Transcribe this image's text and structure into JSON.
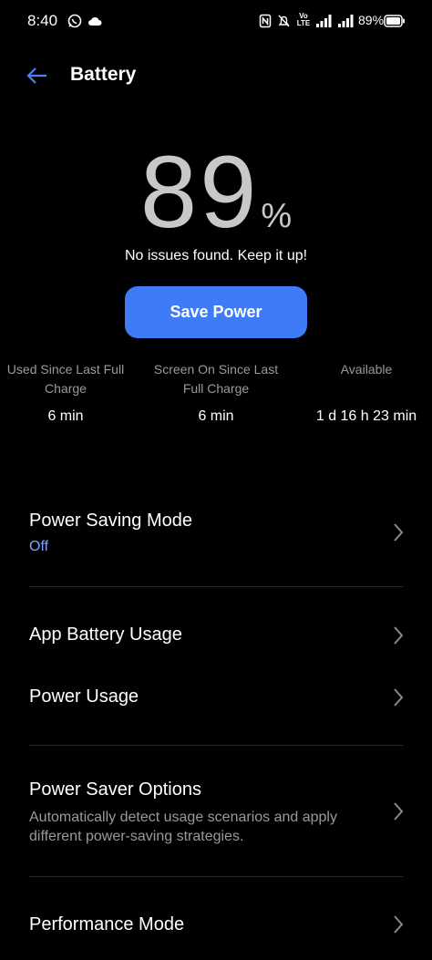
{
  "status_bar": {
    "time": "8:40",
    "battery_percent": "89%",
    "icons": [
      "whatsapp-icon",
      "cloud-icon",
      "nfc-icon",
      "mute-icon",
      "volte-icon",
      "signal-icon",
      "signal-icon",
      "battery-icon"
    ],
    "volte_text": "Vo LTE"
  },
  "header": {
    "title": "Battery"
  },
  "battery": {
    "percent": "89",
    "percent_sign": "%",
    "message": "No issues found. Keep it up!",
    "save_button": "Save Power"
  },
  "stats": [
    {
      "label": "Used Since Last Full Charge",
      "value": "6 min"
    },
    {
      "label": "Screen On Since Last Full Charge",
      "value": "6 min"
    },
    {
      "label": "Available",
      "value": "1 d 16 h 23 min"
    }
  ],
  "menu": {
    "power_saving": {
      "title": "Power Saving Mode",
      "status": "Off"
    },
    "app_usage": {
      "title": "App Battery Usage"
    },
    "power_usage": {
      "title": "Power Usage"
    },
    "saver_options": {
      "title": "Power Saver Options",
      "description": "Automatically detect usage scenarios and apply different power-saving strategies."
    },
    "performance": {
      "title": "Performance Mode"
    }
  },
  "colors": {
    "accent": "#3d7bf7",
    "link": "#7ba2ff",
    "background": "#000000"
  }
}
